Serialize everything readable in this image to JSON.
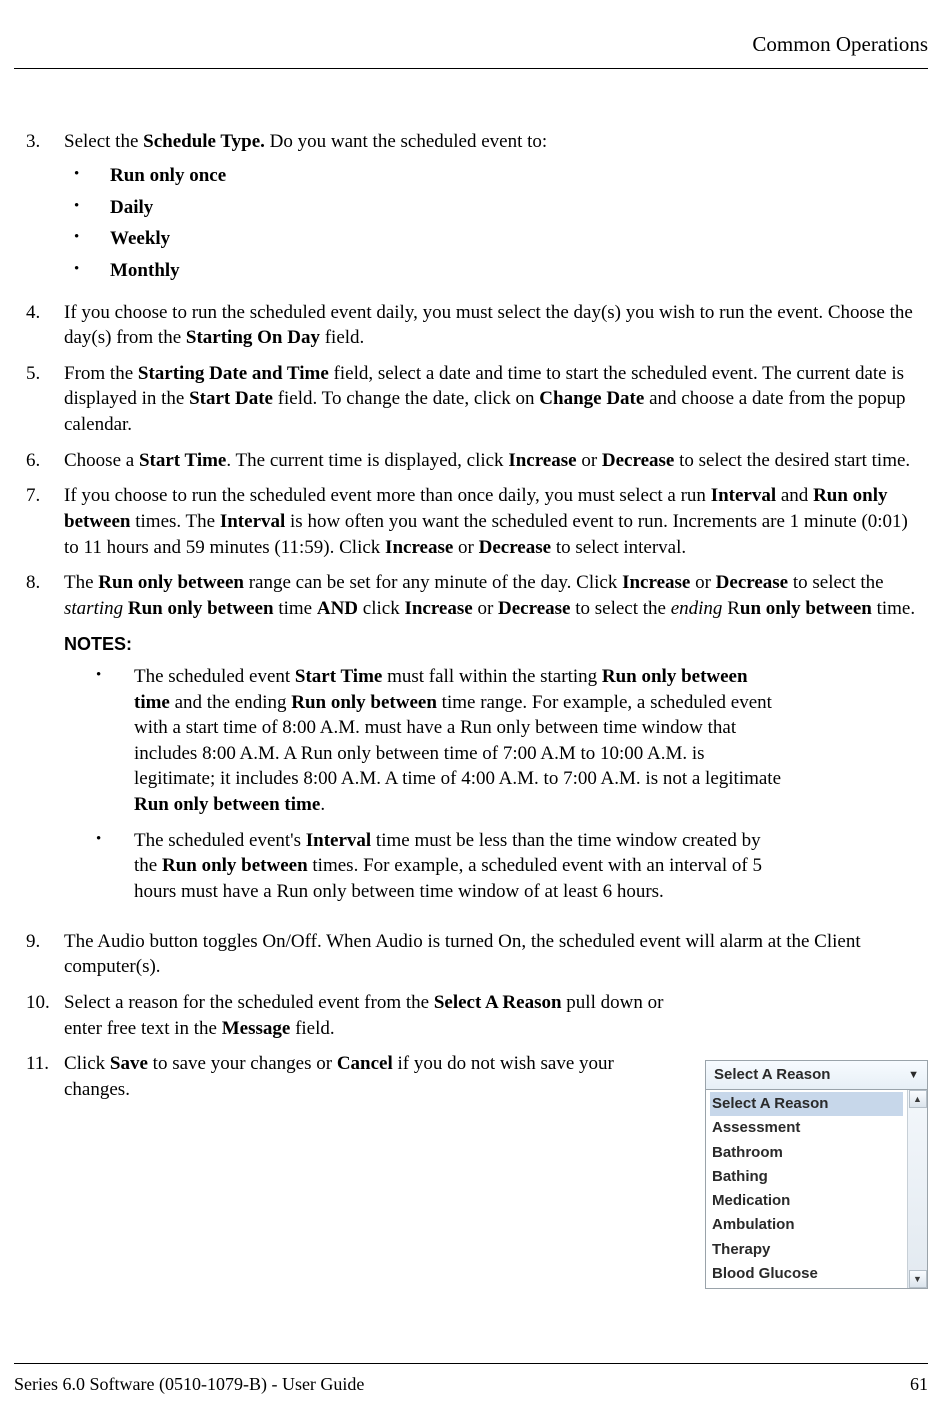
{
  "header": {
    "title": "Common Operations"
  },
  "step3": {
    "intro_pre": "Select the ",
    "intro_bold": "Schedule Type.",
    "intro_post": " Do you want the scheduled event to:",
    "bullets": [
      "Run only once",
      "Daily",
      "Weekly",
      "Monthly"
    ]
  },
  "step4": {
    "text_a": "If you choose to run the scheduled event daily, you must select the day(s) you wish to run the event. Choose the day(s) from the ",
    "bold_a": "Starting On Day",
    "text_b": " field."
  },
  "step5": {
    "a": "From the ",
    "b1": "Starting Date and Time",
    "c": " field, select a date and time to start the scheduled event. The current date is displayed in the ",
    "b2": "Start Date",
    "d": " field. To change the date, click on ",
    "b3": "Change Date",
    "e": " and choose a date from the popup calendar."
  },
  "step6": {
    "a": "Choose a ",
    "b1": "Start Time",
    "c": ". The current time is displayed, click ",
    "b2": "Increase",
    "d": " or ",
    "b3": "Decrease",
    "e": " to select the desired start time."
  },
  "step7": {
    "a": "If you choose to run the scheduled event more than once daily, you must select a run ",
    "b1": "Interval",
    "c": " and ",
    "b2": "Run only between",
    "d": " times. The ",
    "b3": "Interval",
    "e": " is how often you want the scheduled event to run. Increments are 1 minute (0:01) to 11 hours and 59 minutes (11:59). Click ",
    "b4": "Increase",
    "f": " or ",
    "b5": "Decrease",
    "g": " to select interval."
  },
  "step8": {
    "a": "The ",
    "b1": "Run only between",
    "c": " range can be set for any minute of the day. Click ",
    "b2": "Increase",
    "d": " or ",
    "b3": "Decrease",
    "e": " to select the ",
    "i1": "starting",
    "f": " ",
    "b4": "Run only between",
    "g": " time ",
    "b5": "AND",
    "h": " click ",
    "b6": "Increase",
    "i": " or ",
    "b7": "Decrease",
    "j": " to select the ",
    "i2": "ending",
    "k": " R",
    "b8": "un only between",
    "l": " time."
  },
  "notes_label": "NOTES:",
  "note1": {
    "a": "The scheduled event ",
    "b1": "Start Time",
    "c": " must fall within the starting ",
    "b2": "Run only between time",
    "d": " and the ending ",
    "b3": "Run only between",
    "e": " time range. For example, a scheduled event with a start time of 8:00 A.M. must have a Run only between time window that includes 8:00 A.M. A Run only between time of 7:00 A.M to 10:00 A.M. is legitimate; it includes 8:00 A.M. A time of 4:00 A.M. to 7:00 A.M. is not a legitimate ",
    "b4": "Run only between time",
    "f": "."
  },
  "note2": {
    "a": "The scheduled event's ",
    "b1": "Interval",
    "c": " time must be less than the time window created by the ",
    "b2": "Run only between",
    "d": " times. For example, a scheduled event with an interval of 5 hours must have a Run only between time window of at least 6 hours."
  },
  "step9": "The Audio button toggles On/Off. When Audio is turned On, the scheduled event will alarm at the Client computer(s).",
  "step10": {
    "a": "Select a reason for the scheduled event from the ",
    "b1": "Select A Reason",
    "c": " pull down or enter free text in the ",
    "b2": "Message",
    "d": " field."
  },
  "step11": {
    "a": "Click ",
    "b1": "Save",
    "c": " to save your changes or ",
    "b2": "Cancel",
    "d": " if you do not wish save your changes."
  },
  "dropdown": {
    "selected": "Select A Reason",
    "options": [
      "Select A Reason",
      "Assessment",
      "Bathroom",
      "Bathing",
      "Medication",
      "Ambulation",
      "Therapy",
      "Blood Glucose"
    ]
  },
  "footer": {
    "left": "Series 6.0 Software (0510-1079-B) - User Guide",
    "right": "61"
  }
}
